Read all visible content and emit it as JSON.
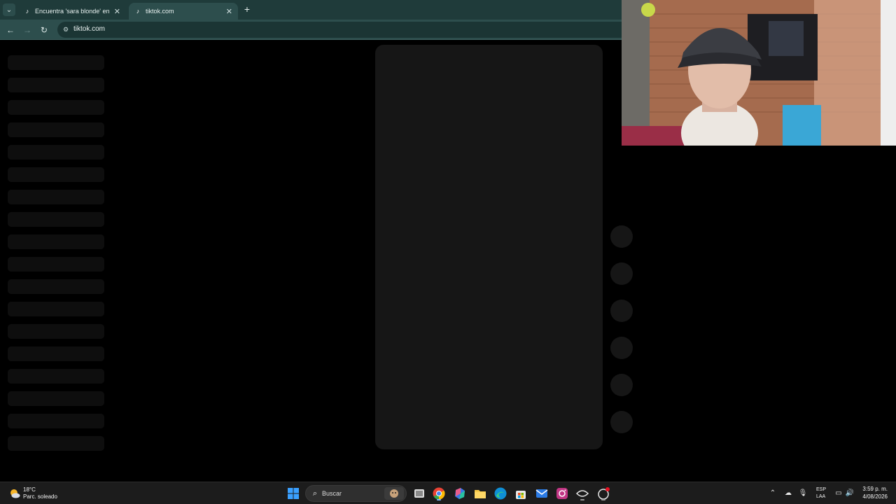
{
  "browser": {
    "tabs": [
      {
        "label": "Encuentra 'sara blonde' en TikT",
        "icon": "tiktok-icon",
        "active": false
      },
      {
        "label": "tiktok.com",
        "icon": "tiktok-icon",
        "active": true
      }
    ],
    "url": "tiktok.com",
    "tab_close_glyph": "✕",
    "new_tab_glyph": "+"
  },
  "page": {
    "skeleton_rows": 18,
    "action_buttons": 6,
    "player_color": "#161616"
  },
  "taskbar": {
    "weather": {
      "temp": "18°C",
      "desc": "Parc. soleado"
    },
    "search_label": "Buscar",
    "language": {
      "code": "ESP",
      "layout": "LAA"
    },
    "clock": {
      "time": "3:59 p. m.",
      "date": "4/08/2026"
    },
    "pinned": [
      "windows-start-icon",
      "task-view-icon",
      "chrome-icon",
      "microsoft-365-icon",
      "file-explorer-icon",
      "edge-icon",
      "microsoft-store-icon",
      "mail-icon",
      "instagram-icon",
      "app-icon",
      "gear-badge-icon"
    ]
  },
  "colors": {
    "tab_bar": "#1f3b3a",
    "toolbar": "#2d4e4d",
    "taskbar": "#1c1c1c",
    "accent": "#7fb7ff"
  }
}
